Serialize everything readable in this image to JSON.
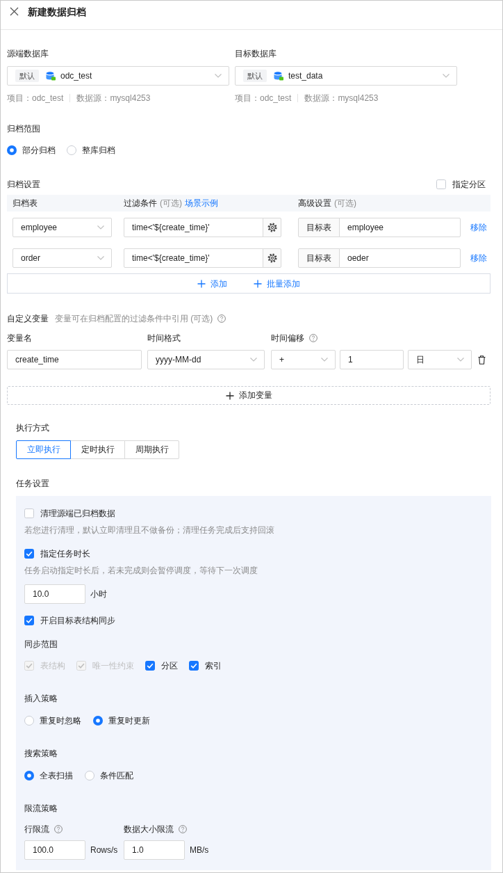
{
  "window": {
    "title": "新建数据归档"
  },
  "databases": [
    {
      "label": "源端数据库",
      "tag": "默认",
      "value": "odc_test",
      "meta": [
        "项目：odc_test",
        "数据源：mysql4253"
      ]
    },
    {
      "label": "目标数据库",
      "tag": "默认",
      "value": "test_data",
      "meta": [
        "项目：odc_test",
        "数据源：mysql4253"
      ]
    }
  ],
  "archive_scope": {
    "label": "归档范围",
    "options": [
      {
        "label": "部分归档",
        "selected": true
      },
      {
        "label": "整库归档",
        "selected": false
      }
    ]
  },
  "archive_settings": {
    "label": "归档设置",
    "partition": {
      "label": "指定分区",
      "checked": false
    },
    "columns": [
      {
        "label": "归档表"
      },
      {
        "label": "过滤条件",
        "note": "(可选)",
        "link": "场景示例"
      },
      {
        "label": "高级设置",
        "note": "(可选)"
      }
    ],
    "rows": [
      {
        "table": "employee",
        "filter": "time<'${create_time}'",
        "target_label": "目标表",
        "target": "employee",
        "action": "移除"
      },
      {
        "table": "order",
        "filter": "time<'${create_time}'",
        "target_label": "目标表",
        "target": "oeder",
        "action": "移除"
      }
    ],
    "actions": [
      "添加",
      "批量添加"
    ]
  },
  "custom_variables": {
    "label": "自定义变量",
    "description": "变量可在归档配置的过滤条件中引用 (可选)",
    "columns": [
      {
        "label": "变量名",
        "help": false
      },
      {
        "label": "时间格式",
        "help": false
      },
      {
        "label": "时间偏移",
        "help": true
      }
    ],
    "rows": [
      {
        "name": "create_time",
        "format": "yyyy-MM-dd",
        "sign": "+",
        "amount": "1",
        "unit": "日"
      }
    ],
    "add_label": "添加变量"
  },
  "execution": {
    "label": "执行方式",
    "options": [
      {
        "label": "立即执行",
        "selected": true
      },
      {
        "label": "定时执行",
        "selected": false
      },
      {
        "label": "周期执行",
        "selected": false
      }
    ]
  },
  "task_settings": {
    "label": "任务设置",
    "items": [
      {
        "kind": "checkbox",
        "label": "清理源端已归档数据",
        "checked": false,
        "hint": "若您进行清理，默认立即清理且不做备份；清理任务完成后支持回滚"
      },
      {
        "kind": "checkbox",
        "label": "指定任务时长",
        "checked": true,
        "hint": "任务启动指定时长后，若未完成则会暂停调度，等待下一次调度",
        "value": "10.0",
        "unit": "小时"
      },
      {
        "kind": "checkbox",
        "label": "开启目标表结构同步",
        "checked": true
      },
      {
        "kind": "checkgroup",
        "label": "同步范围",
        "options": [
          {
            "label": "表结构",
            "checked": true,
            "disabled": true
          },
          {
            "label": "唯一性约束",
            "checked": true,
            "disabled": true
          },
          {
            "label": "分区",
            "checked": true,
            "disabled": false
          },
          {
            "label": "索引",
            "checked": true,
            "disabled": false
          }
        ]
      },
      {
        "kind": "radiogroup",
        "label": "插入策略",
        "options": [
          {
            "label": "重复时忽略",
            "selected": false
          },
          {
            "label": "重复时更新",
            "selected": true
          }
        ]
      },
      {
        "kind": "radiogroup",
        "label": "搜索策略",
        "options": [
          {
            "label": "全表扫描",
            "selected": true
          },
          {
            "label": "条件匹配",
            "selected": false
          }
        ]
      },
      {
        "kind": "inputs",
        "label": "限流策略",
        "fields": [
          {
            "label": "行限流",
            "help": true,
            "value": "100.0",
            "unit": "Rows/s"
          },
          {
            "label": "数据大小限流",
            "help": true,
            "value": "1.0",
            "unit": "MB/s"
          }
        ]
      }
    ]
  }
}
